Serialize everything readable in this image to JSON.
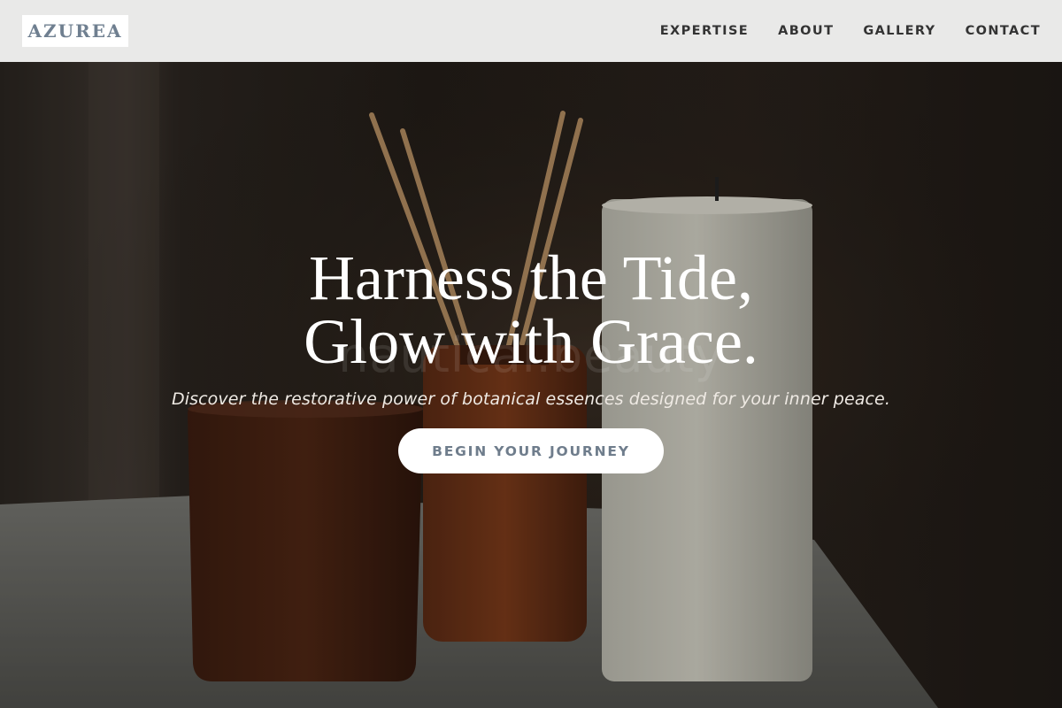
{
  "header": {
    "logo": "AZUREA",
    "nav": [
      {
        "label": "EXPERTISE"
      },
      {
        "label": "ABOUT"
      },
      {
        "label": "GALLERY"
      },
      {
        "label": "CONTACT"
      }
    ]
  },
  "hero": {
    "watermark": "nautical.beauty",
    "headline_line1": "Harness the Tide,",
    "headline_line2": "Glow with Grace.",
    "subline": "Discover the restorative power of botanical essences designed for your inner peace.",
    "cta_label": "BEGIN YOUR JOURNEY"
  },
  "colors": {
    "header_bg": "#e9e9e8",
    "logo_text": "#6f7f90",
    "nav_text": "#333333",
    "cta_text": "#6f7d8c",
    "cta_bg": "#ffffff"
  }
}
